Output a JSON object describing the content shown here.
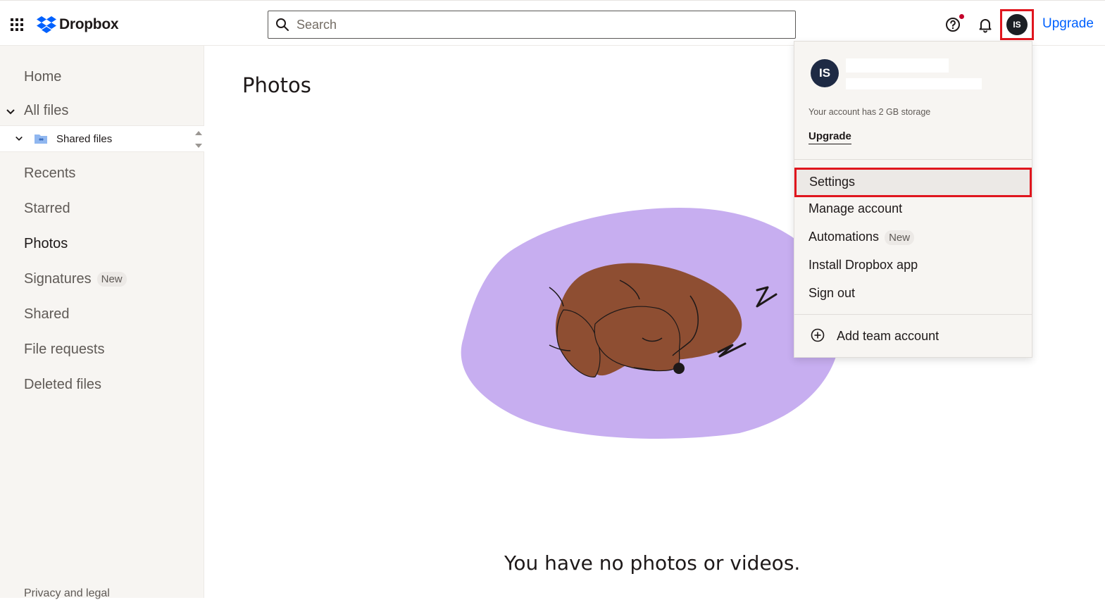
{
  "header": {
    "logo_text": "Dropbox",
    "search_placeholder": "Search",
    "avatar_initials": "IS",
    "upgrade_label": "Upgrade"
  },
  "sidebar": {
    "items": [
      {
        "label": "Home"
      },
      {
        "label": "All files"
      },
      {
        "label": "Shared files"
      },
      {
        "label": "Recents"
      },
      {
        "label": "Starred"
      },
      {
        "label": "Photos"
      },
      {
        "label": "Signatures",
        "badge": "New"
      },
      {
        "label": "Shared"
      },
      {
        "label": "File requests"
      },
      {
        "label": "Deleted files"
      }
    ],
    "footer_link": "Privacy and legal"
  },
  "main": {
    "title": "Photos",
    "empty_message": "You have no photos or videos."
  },
  "account_menu": {
    "avatar_initials": "IS",
    "storage_text": "Your account has 2 GB storage",
    "upgrade_label": "Upgrade",
    "items": [
      {
        "label": "Settings"
      },
      {
        "label": "Manage account"
      },
      {
        "label": "Automations",
        "badge": "New"
      },
      {
        "label": "Install Dropbox app"
      },
      {
        "label": "Sign out"
      }
    ],
    "add_team_label": "Add team account"
  },
  "colors": {
    "accent_blue": "#0061fe",
    "highlight_red": "#e0161e",
    "blob_purple": "#c7aef0",
    "dog_brown": "#8e4e32"
  }
}
